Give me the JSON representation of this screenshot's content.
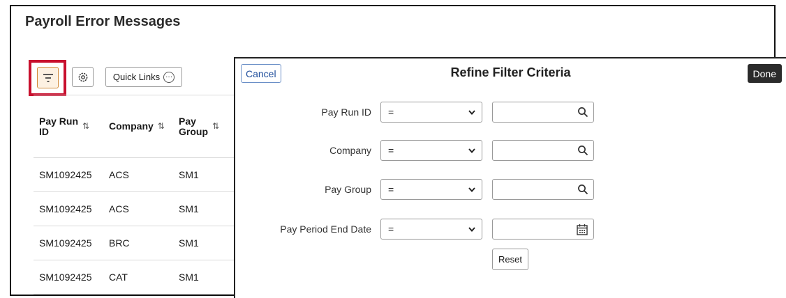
{
  "page": {
    "title": "Payroll Error Messages"
  },
  "toolbar": {
    "filter_icon": "filter-icon",
    "settings_icon": "gear-icon",
    "quick_links_label": "Quick Links",
    "quick_links_icon": "ellipsis-circle-icon",
    "highlight_color": "#c8102e"
  },
  "grid": {
    "columns": [
      {
        "label": "Pay Run ID",
        "line1": "Pay Run",
        "line2": "ID",
        "sort": "⇅"
      },
      {
        "label": "Company",
        "line1": "Company",
        "line2": "",
        "sort": "⇅"
      },
      {
        "label": "Pay Group",
        "line1": "Pay",
        "line2": "Group",
        "sort": "⇅"
      }
    ],
    "rows": [
      [
        "SM1092425",
        "ACS",
        "SM1"
      ],
      [
        "SM1092425",
        "ACS",
        "SM1"
      ],
      [
        "SM1092425",
        "BRC",
        "SM1"
      ],
      [
        "SM1092425",
        "CAT",
        "SM1"
      ]
    ]
  },
  "modal": {
    "title": "Refine Filter Criteria",
    "cancel_label": "Cancel",
    "done_label": "Done",
    "reset_label": "Reset",
    "filters": [
      {
        "label": "Pay Run ID",
        "operator": "=",
        "value": "",
        "icon": "search-icon"
      },
      {
        "label": "Company",
        "operator": "=",
        "value": "",
        "icon": "search-icon"
      },
      {
        "label": "Pay Group",
        "operator": "=",
        "value": "",
        "icon": "search-icon"
      },
      {
        "label": "Pay Period End Date",
        "operator": "=",
        "value": "",
        "icon": "calendar-icon"
      }
    ]
  }
}
